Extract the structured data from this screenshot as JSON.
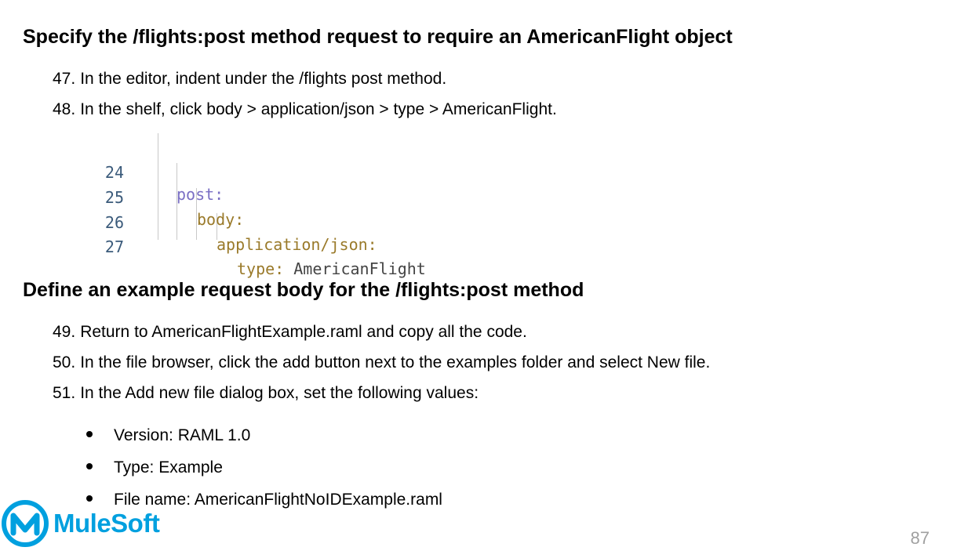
{
  "headings": {
    "first": "Specify the /flights:post method request to require an AmericanFlight object",
    "second": "Define an example request body for the /flights:post method"
  },
  "steps": [
    {
      "num": "47.",
      "text": "In the editor, indent under the /flights post method."
    },
    {
      "num": "48.",
      "text": "In the shelf, click body > application/json > type > AmericanFlight."
    },
    {
      "num": "49.",
      "text": "Return to AmericanFlightExample.raml and copy all the code."
    },
    {
      "num": "50.",
      "text": "In the file browser, click the add button next to the examples folder and select New file."
    },
    {
      "num": "51.",
      "text": "In the Add new file dialog box, set the following values:"
    }
  ],
  "code": {
    "lines": [
      {
        "num": "24",
        "key": "post:",
        "value": ""
      },
      {
        "num": "25",
        "key": "body:",
        "value": ""
      },
      {
        "num": "26",
        "key": "application/json:",
        "value": ""
      },
      {
        "num": "27",
        "key": "type:",
        "value": " AmericanFlight"
      }
    ]
  },
  "bullets": [
    "Version: RAML 1.0",
    "Type: Example",
    "File name: AmericanFlightNoIDExample.raml"
  ],
  "footer": {
    "logo_text": "MuleSoft",
    "page_number": "87"
  },
  "colors": {
    "brand": "#00a0df",
    "code_key_post": "#7a6fc4",
    "code_key": "#9a7a2a",
    "code_value": "#444444",
    "line_number": "#3a5a7a",
    "page_number": "#a0a0a0"
  }
}
